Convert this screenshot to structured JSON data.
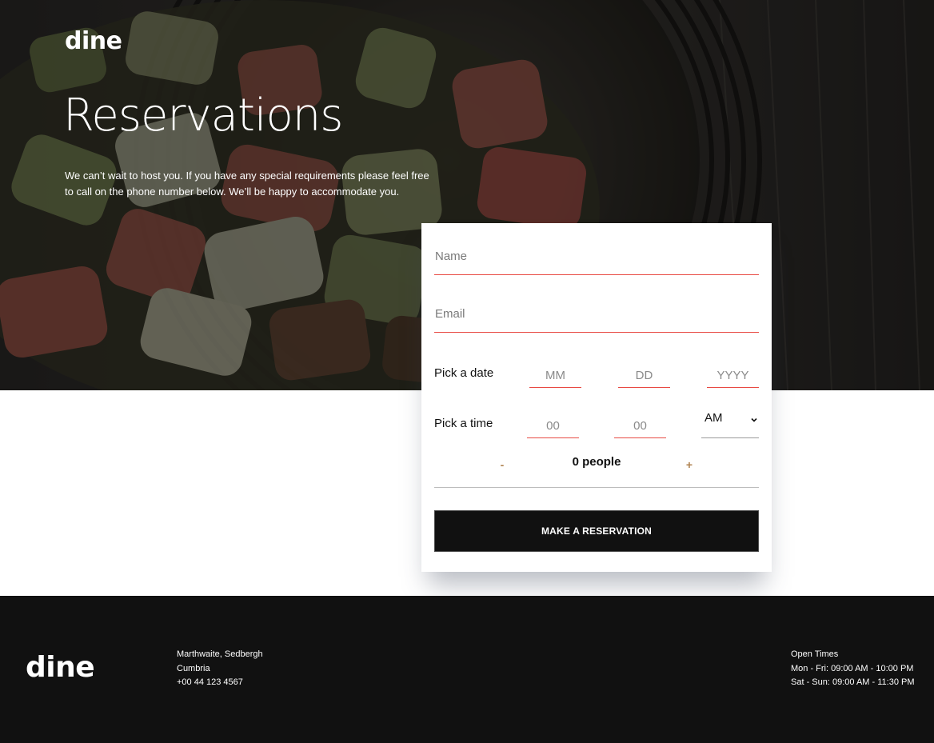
{
  "header": {
    "logo": "dine",
    "title": "Reservations",
    "description": "We can’t wait to host you. If you have any special requirements please feel free to call on the phone number below. We’ll be happy to accommodate you."
  },
  "form": {
    "name_placeholder": "Name",
    "email_placeholder": "Email",
    "date_label": "Pick a date",
    "date_mm_placeholder": "MM",
    "date_dd_placeholder": "DD",
    "date_yyyy_placeholder": "YYYY",
    "time_label": "Pick a time",
    "time_hour_placeholder": "00",
    "time_minute_placeholder": "00",
    "ampm_value": "AM",
    "people_minus": "-",
    "people_value": "0 people",
    "people_plus": "+",
    "submit_label": "MAKE A RESERVATION"
  },
  "footer": {
    "logo": "dine",
    "address_line1": "Marthwaite, Sedbergh",
    "address_line2": "Cumbria",
    "phone": "+00 44 123 4567",
    "hours_title": "Open Times",
    "hours_weekday": "Mon - Fri: 09:00 AM - 10:00 PM",
    "hours_weekend": "Sat - Sun: 09:00 AM - 11:30 PM"
  },
  "colors": {
    "accent_underline": "#e84a43",
    "counter_accent": "#b08350",
    "footer_bg": "#111111",
    "button_bg": "#111111"
  },
  "icons": {
    "dropdown": "chevron-down-icon"
  }
}
